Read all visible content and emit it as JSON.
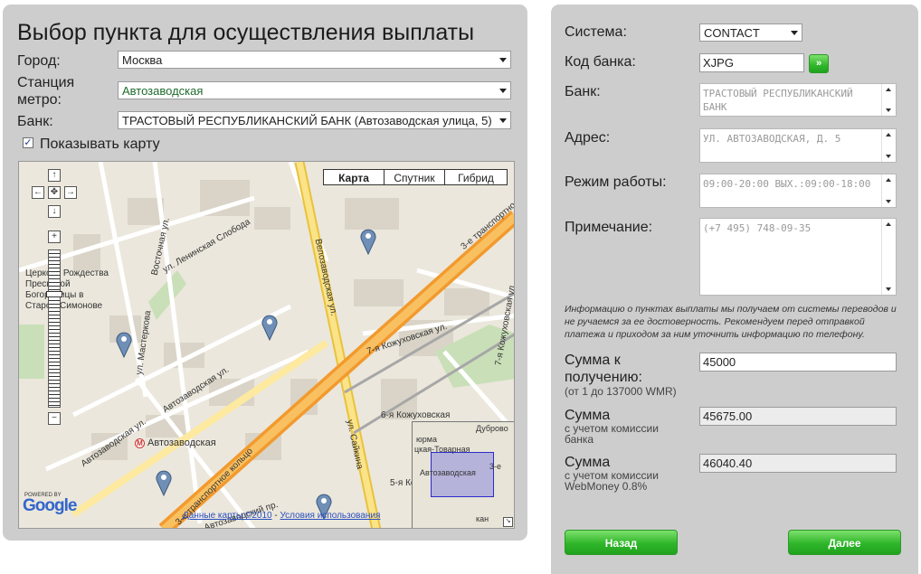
{
  "left": {
    "title": "Выбор пункта для осуществления выплаты",
    "city_label": "Город:",
    "city_value": "Москва",
    "metro_label_1": "Станция",
    "metro_label_2": "метро:",
    "metro_value": "Автозаводская",
    "bank_label": "Банк:",
    "bank_value": "ТРАСТОВЫЙ РЕСПУБЛИКАНСКИЙ БАНК (Автозаводская улица, 5)",
    "show_map_label": "Показывать карту",
    "show_map_checked": true
  },
  "map": {
    "types": [
      "Карта",
      "Спутник",
      "Гибрид"
    ],
    "active_type": "Карта",
    "street_labels": [
      "Велозаводская ул.",
      "Восточная ул.",
      "ул. Ленинская Слобода",
      "ул. Мастеркова",
      "Автозаводская ул.",
      "3-е транспортное кольцо",
      "ул. Сайкина",
      "7-я Кожуховская ул.",
      "3-е транспортное кольцо",
      "Автозаводская",
      "Церковь Рождества Пресвятой Богородицы в Старом Симонове",
      "Автозаводский пр.",
      "6-я Кожуховская",
      "5-я Кожуховская",
      "7-я Кожуховская ул."
    ],
    "church_lines": [
      "Церковь Рождества",
      "Пресвятой",
      "Богородицы в",
      "Старом Симонове"
    ],
    "metro_letter": "М",
    "metro_station": "Автозаводская",
    "powered_by": "POWERED BY",
    "google_logo": "Google",
    "attribution_data": "Данные карты ©2010",
    "attribution_sep": " - ",
    "attribution_terms": "Условия использования",
    "overview_labels": [
      "Дуброво",
      "юрма",
      "цкая-Товарная",
      "Автозаводская",
      "3-е",
      "кан"
    ]
  },
  "right": {
    "system_label": "Система:",
    "system_value": "CONTACT",
    "bank_code_label": "Код банка:",
    "bank_code_value": "XJPG",
    "go_label": "»",
    "bank_label": "Банк:",
    "bank_value": "ТРАСТОВЫЙ РЕСПУБЛИКАНСКИЙ БАНК",
    "address_label": "Адрес:",
    "address_value": "УЛ. АВТОЗАВОДСКАЯ, Д. 5",
    "hours_label": "Режим работы:",
    "hours_value": "09:00-20:00 ВЫХ.:09:00-18:00",
    "note_label": "Примечание:",
    "note_value": "(+7 495) 748-09-35",
    "info_text": "Информацию о пунктах выплаты мы получаем от системы переводов и не ручаемся за ее достоверность. Рекомендуем перед отправкой платежа и приходом за ним уточнить информацию по телефону.",
    "receive_label_1": "Сумма к",
    "receive_label_2": "получению:",
    "receive_sub": "(от 1 до 137000 WMR)",
    "receive_value": "45000",
    "bank_fee_label": "Сумма",
    "bank_fee_sub_1": "с учетом комиссии",
    "bank_fee_sub_2": "банка",
    "bank_fee_value": "45675.00",
    "wm_fee_label": "Сумма",
    "wm_fee_sub_1": "с учетом комиссии",
    "wm_fee_sub_2": "WebMoney 0.8%",
    "wm_fee_value": "46040.40",
    "back_label": "Назад",
    "next_label": "Далее"
  },
  "colors": {
    "panel_bg": "#cdcdcd",
    "button_green": "#2fb62a",
    "metro_text": "#1f6b2a",
    "highway": "#f5c842",
    "link": "#2a4fbf"
  }
}
